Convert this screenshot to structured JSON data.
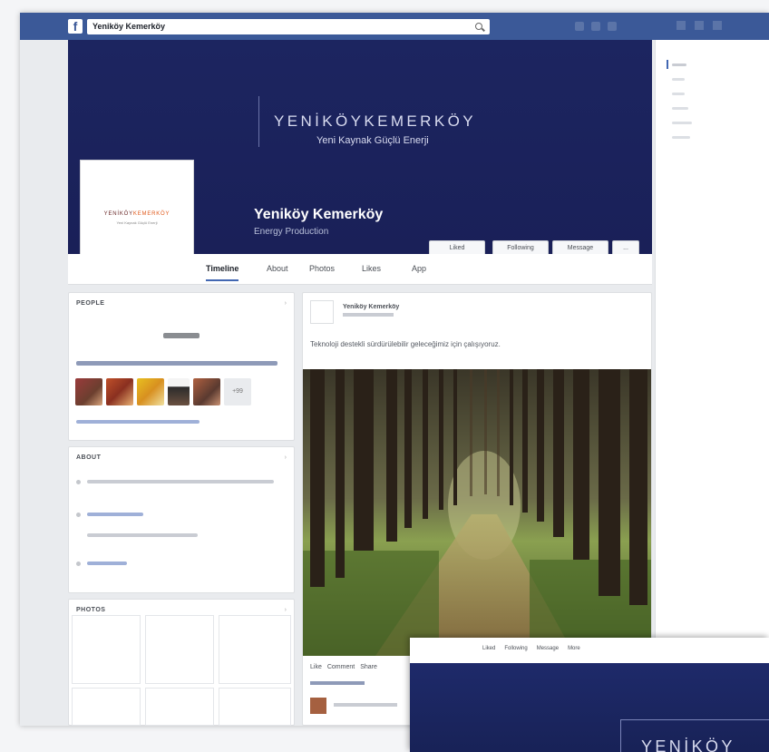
{
  "topbar": {
    "search_value": "Yeniköy Kemerköy",
    "logo": "f"
  },
  "cover": {
    "brand": "YENİKÖYKEMERKÖY",
    "tagline": "Yeni Kaynak Güçlü Enerji",
    "page_name": "Yeniköy Kemerköy",
    "category": "Energy Production",
    "buttons": [
      "Liked",
      "Following",
      "Message",
      "..."
    ]
  },
  "profile": {
    "brand_a": "YENİKÖY",
    "brand_b": "KEMERKÖY",
    "sub": "Yeni Kaynak Güçlü Enerji"
  },
  "tabs": [
    "Timeline",
    "About",
    "Photos",
    "Likes",
    "App"
  ],
  "left": {
    "people_title": "PEOPLE",
    "about_title": "ABOUT",
    "photos_title": "PHOTOS",
    "plus_count": "+99"
  },
  "post": {
    "author": "Yeniköy Kemerköy",
    "text": "Teknoloji destekli sürdürülebilir geleceğimiz için çalışıyoruz.",
    "actions": [
      "Like",
      "Comment",
      "Share"
    ]
  },
  "mobile": {
    "tabs": [
      "Liked",
      "Following",
      "Message",
      "More"
    ],
    "brand": "YENİKÖY"
  },
  "colors": {
    "fb_blue": "#3b5998",
    "cover_navy": "#1c2560",
    "accent_orange": "#e05a1c"
  }
}
